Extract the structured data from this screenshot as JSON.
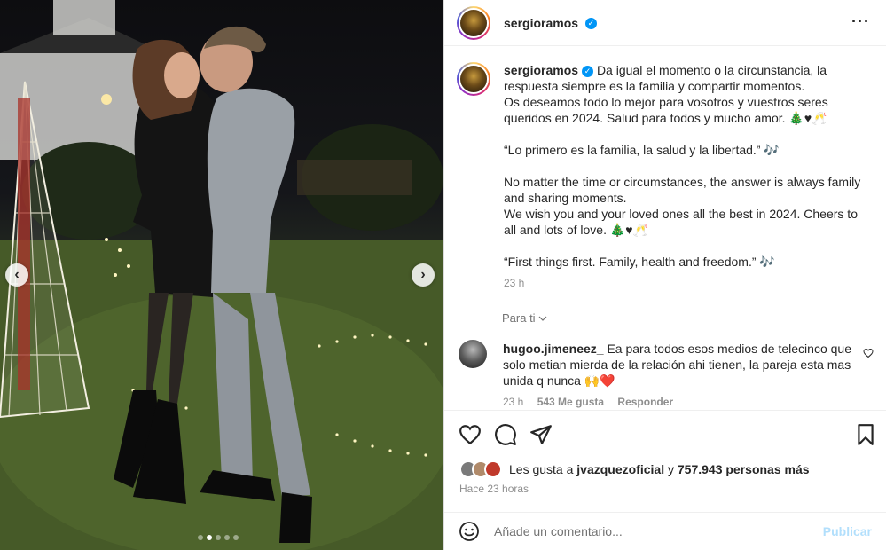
{
  "post": {
    "author": "sergioramos",
    "caption_paragraphs": [
      "Da igual el momento o la circunstancia, la respuesta siempre es la familia y compartir momentos.\nOs deseamos todo lo mejor para vosotros y vuestros seres queridos en 2024. Salud para todos y mucho amor. 🎄♥🥂",
      "“Lo primero es la familia, la salud y la libertad.” 🎶",
      "No matter the time or circumstances, the answer is always family and sharing moments.\nWe wish you and your loved ones all the best in 2024. Cheers to all and lots of love. 🎄♥🥂",
      "“First things first. Family, health and freedom.” 🎶"
    ],
    "caption_time": "23 h",
    "translate_label": "Para ti"
  },
  "comment": {
    "username": "hugoo.jimeneez_",
    "text": "Ea para todos esos medios de telecinco que solo metian mierda de la relación ahi tienen, la pareja esta mas unida q nunca 🙌❤️",
    "time": "23 h",
    "likes": "543 Me gusta",
    "reply": "Responder"
  },
  "likes": {
    "prefix": "Les gusta a",
    "first_user": "jvazquezoficial",
    "joiner": "y",
    "count_text": "757.943 personas más"
  },
  "posted_when": "Hace 23 horas",
  "add_comment": {
    "placeholder": "Añade un comentario...",
    "publish": "Publicar"
  },
  "carousel": {
    "slides": 5,
    "active": 1
  },
  "colors": {
    "verified": "#0095f6",
    "publish_disabled": "#b2dffc",
    "secondary_text": "#8e8e8e"
  },
  "icons": [
    "more-options-icon",
    "heart-icon",
    "comment-icon",
    "share-icon",
    "bookmark-icon",
    "emoji-icon",
    "chevron-down-icon",
    "verified-icon"
  ]
}
